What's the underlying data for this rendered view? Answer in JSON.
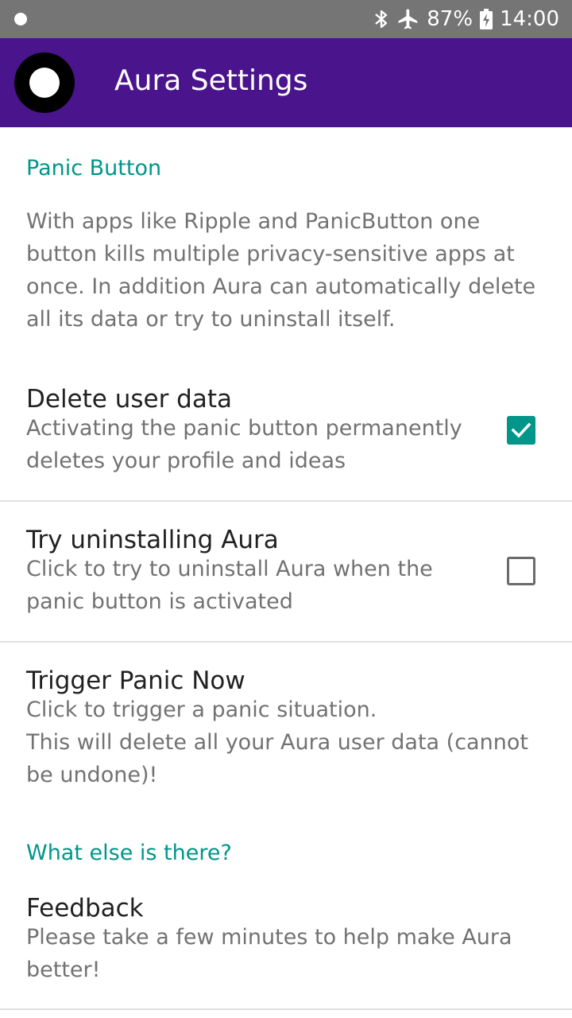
{
  "status_bar": {
    "icons": [
      "notification-dot-icon",
      "bluetooth-icon",
      "airplane-icon",
      "battery-charging-icon"
    ],
    "battery": "87%",
    "time": "14:00"
  },
  "app_bar": {
    "title": "Aura Settings",
    "color": "#4a148c"
  },
  "sections": {
    "panic": {
      "header": "Panic Button",
      "description": "With apps like Ripple and PanicButton one button kills multiple privacy-sensitive apps at once. In addition Aura can automatically delete all its data or try to uninstall itself."
    },
    "more": {
      "header": "What else is there?"
    }
  },
  "prefs": {
    "delete_data": {
      "title": "Delete user data",
      "summary": "Activating the panic button permanently deletes your profile and ideas",
      "checked": true
    },
    "uninstall": {
      "title": "Try uninstalling Aura",
      "summary": "Click to try to uninstall Aura when the panic button is activated",
      "checked": false
    },
    "trigger": {
      "title": "Trigger Panic Now",
      "summary": "Click to trigger a panic situation.\nThis will delete all your Aura user data (cannot be undone)!"
    },
    "feedback": {
      "title": "Feedback",
      "summary": "Please take a few minutes to help make Aura better!"
    }
  },
  "accent_color": "#00968a"
}
